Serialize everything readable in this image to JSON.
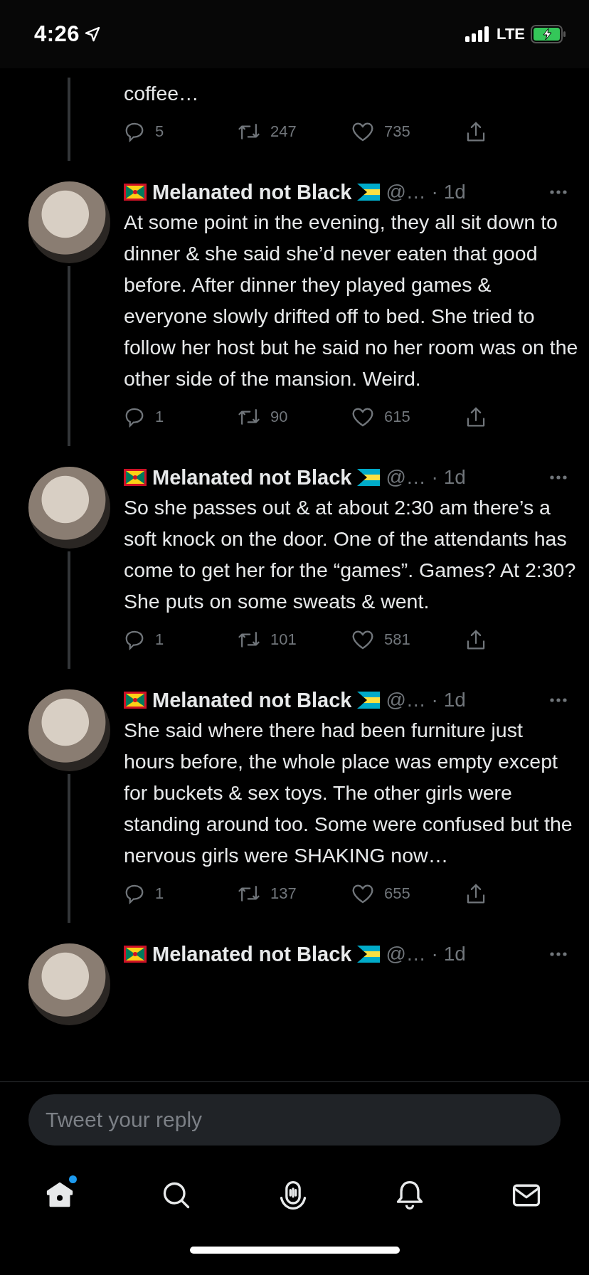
{
  "status_bar": {
    "time": "4:26",
    "network": "LTE",
    "charging": true
  },
  "tweets": [
    {
      "kind": "continuation",
      "text": "coffee…",
      "replies": "5",
      "retweets": "247",
      "likes": "735"
    },
    {
      "kind": "full",
      "name": "Melanated not Black",
      "meta": "@… · 1d",
      "text": "At some point in the evening, they all sit down to dinner & she said she’d never eaten that good before. After dinner they played games & everyone slowly drifted off to bed. She tried to follow her host but he said no her room was on the other side of the mansion. Weird.",
      "replies": "1",
      "retweets": "90",
      "likes": "615"
    },
    {
      "kind": "full",
      "name": "Melanated not Black",
      "meta": "@… · 1d",
      "text": "So she passes out & at about 2:30 am there’s a soft knock on the door. One of the attendants has come to get her for the “games”. Games? At 2:30? She puts on some sweats & went.",
      "replies": "1",
      "retweets": "101",
      "likes": "581"
    },
    {
      "kind": "full",
      "name": "Melanated not Black",
      "meta": "@… · 1d",
      "text": "She said where there had been furniture just hours before, the whole place was empty except for buckets & sex toys. The other girls were standing around too. Some were confused but the nervous girls were SHAKING now…",
      "replies": "1",
      "retweets": "137",
      "likes": "655"
    },
    {
      "kind": "header_only",
      "name": "Melanated not Black",
      "meta": "@… · 1d"
    }
  ],
  "reply": {
    "placeholder": "Tweet your reply"
  },
  "nav": [
    {
      "kind": "home",
      "selected": true,
      "unread": true
    },
    {
      "kind": "search",
      "selected": false,
      "unread": false
    },
    {
      "kind": "spaces",
      "selected": false,
      "unread": false
    },
    {
      "kind": "notifications",
      "selected": false,
      "unread": false
    },
    {
      "kind": "messages",
      "selected": false,
      "unread": false
    }
  ]
}
